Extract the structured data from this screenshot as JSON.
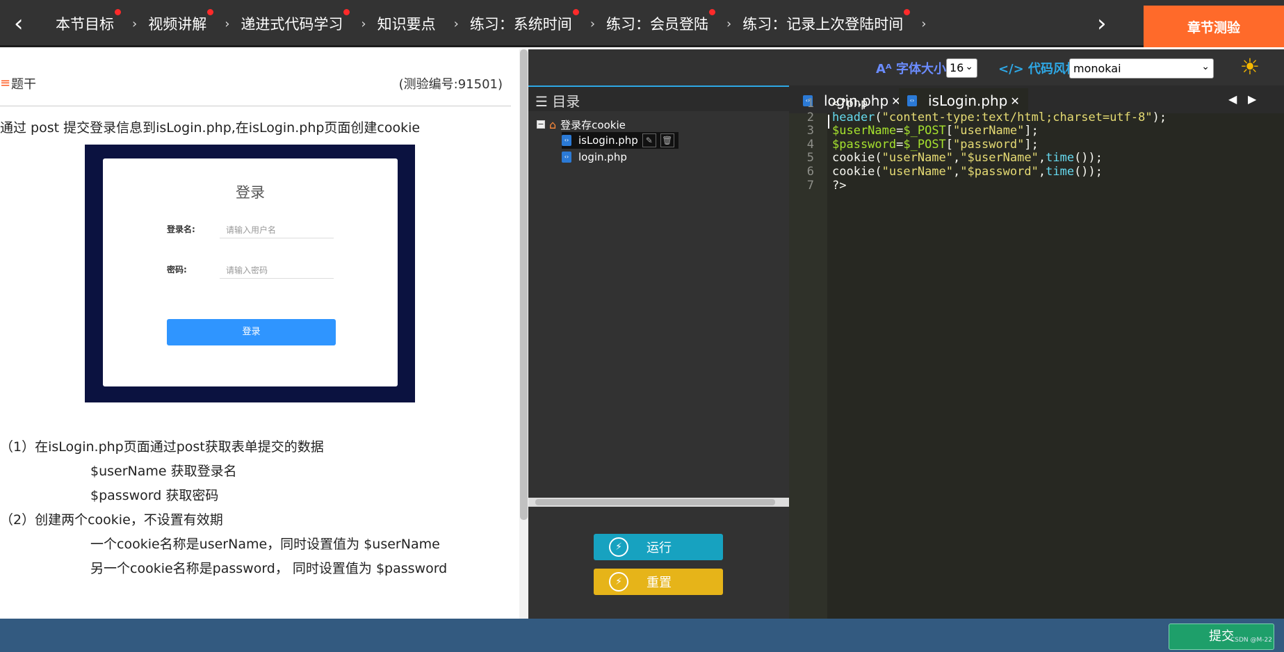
{
  "nav": {
    "items": [
      {
        "label": "本节目标",
        "dot": true
      },
      {
        "label": "视频讲解",
        "dot": true
      },
      {
        "label": "递进式代码学习",
        "dot": true
      },
      {
        "label": "知识要点",
        "dot": false
      },
      {
        "label": "练习：系统时间",
        "dot": true
      },
      {
        "label": "练习：会员登陆",
        "dot": true
      },
      {
        "label": "练习：记录上次登陆时间",
        "dot": true
      }
    ],
    "back_icon": "‹",
    "next_icon": "›",
    "test_button": "章节测验"
  },
  "question": {
    "title": "题干",
    "code": "(测验编号:91501)",
    "description": "通过 post 提交登录信息到isLogin.php,在isLogin.php页面创建cookie",
    "login_preview": {
      "title": "登录",
      "username_label": "登录名:",
      "username_placeholder": "请输入用户名",
      "password_label": "密码:",
      "password_placeholder": "请输入密码",
      "button": "登录"
    },
    "requirements": [
      "（1）在isLogin.php页面通过post获取表单提交的数据",
      "$userName 获取登录名",
      "$password 获取密码",
      "（2）创建两个cookie，不设置有效期",
      "一个cookie名称是userName，同时设置值为 $userName",
      "另一个cookie名称是password，  同时设置值为 $password"
    ]
  },
  "toolbar": {
    "font_size_label": "字体大小",
    "font_size_value": "16",
    "code_style_label": "代码风格",
    "code_style_value": "monokai"
  },
  "tree": {
    "title": "目录",
    "root": "登录存cookie",
    "files": [
      "isLogin.php",
      "login.php"
    ]
  },
  "buttons": {
    "run": "运行",
    "reset": "重置",
    "submit": "提交"
  },
  "editor": {
    "tabs": [
      "login.php",
      "isLogin.php"
    ],
    "active_tab": "isLogin.php",
    "line_numbers": [
      "1",
      "2",
      "3",
      "4",
      "5",
      "6",
      "7"
    ],
    "code_lines": [
      [
        {
          "t": "<?php",
          "c": "plain"
        }
      ],
      [
        {
          "t": "header",
          "c": "kw"
        },
        {
          "t": "(",
          "c": "plain"
        },
        {
          "t": "\"content-type:text/html;charset=utf-8\"",
          "c": "str"
        },
        {
          "t": ");",
          "c": "plain"
        }
      ],
      [
        {
          "t": "$userName",
          "c": "var"
        },
        {
          "t": "=",
          "c": "plain"
        },
        {
          "t": "$_POST",
          "c": "var"
        },
        {
          "t": "[",
          "c": "plain"
        },
        {
          "t": "\"userName\"",
          "c": "str"
        },
        {
          "t": "];",
          "c": "plain"
        }
      ],
      [
        {
          "t": "$password",
          "c": "var"
        },
        {
          "t": "=",
          "c": "plain"
        },
        {
          "t": "$_POST",
          "c": "var"
        },
        {
          "t": "[",
          "c": "plain"
        },
        {
          "t": "\"password\"",
          "c": "str"
        },
        {
          "t": "];",
          "c": "plain"
        }
      ],
      [
        {
          "t": "cookie(",
          "c": "plain"
        },
        {
          "t": "\"userName\"",
          "c": "str"
        },
        {
          "t": ",",
          "c": "plain"
        },
        {
          "t": "\"$userName\"",
          "c": "str"
        },
        {
          "t": ",",
          "c": "plain"
        },
        {
          "t": "time",
          "c": "kw"
        },
        {
          "t": "());",
          "c": "plain"
        }
      ],
      [
        {
          "t": "cookie(",
          "c": "plain"
        },
        {
          "t": "\"userName\"",
          "c": "str"
        },
        {
          "t": ",",
          "c": "plain"
        },
        {
          "t": "\"$password\"",
          "c": "str"
        },
        {
          "t": ",",
          "c": "plain"
        },
        {
          "t": "time",
          "c": "kw"
        },
        {
          "t": "());",
          "c": "plain"
        }
      ],
      [
        {
          "t": "?>",
          "c": "plain"
        }
      ]
    ]
  },
  "watermark": "CSDN @M-22"
}
